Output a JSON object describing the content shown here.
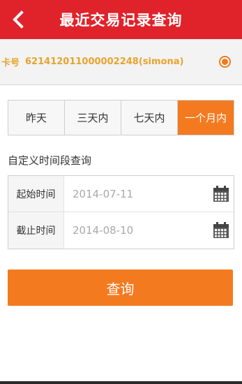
{
  "header": {
    "title": "最近交易记录查询",
    "back_icon": "chevron-left-icon",
    "color": "#e0232b"
  },
  "card": {
    "label": "卡号",
    "number": "621412011000002248(simona)",
    "selected": true,
    "accent_color": "#e8a32c"
  },
  "tabs": [
    {
      "label": "昨天",
      "active": false
    },
    {
      "label": "三天内",
      "active": false
    },
    {
      "label": "七天内",
      "active": false
    },
    {
      "label": "一个月内",
      "active": true
    }
  ],
  "custom": {
    "title": "自定义时间段查询",
    "start": {
      "label": "起始时间",
      "value": "2014-07-11",
      "icon": "calendar-icon"
    },
    "end": {
      "label": "截止时间",
      "value": "2014-08-10",
      "icon": "calendar-icon"
    }
  },
  "query_button": {
    "label": "查询",
    "color": "#f47a20"
  }
}
